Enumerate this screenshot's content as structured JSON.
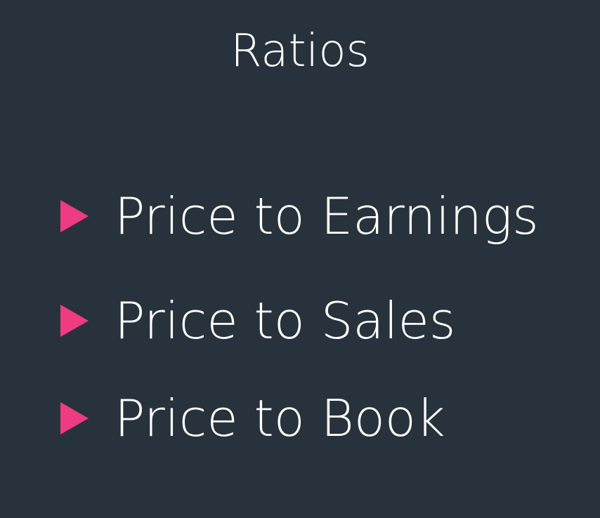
{
  "slide": {
    "title": "Ratios",
    "bullets": [
      {
        "label": "Price to Earnings",
        "icon": "triangle-right-icon"
      },
      {
        "label": "Price to Sales",
        "icon": "triangle-right-icon"
      },
      {
        "label": "Price to Book",
        "icon": "triangle-right-icon"
      }
    ]
  },
  "colors": {
    "background": "#28323c",
    "text": "#ffffff",
    "accent": "#ee3b82"
  }
}
